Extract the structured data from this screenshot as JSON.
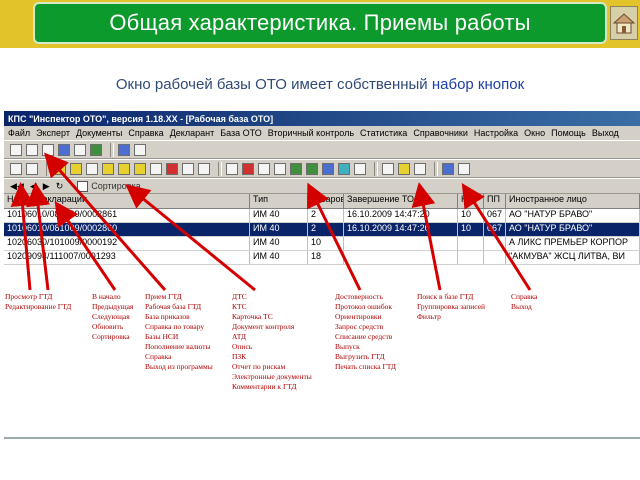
{
  "slide": {
    "title": "Общая характеристика.  Приемы работы",
    "subtitle_part1": "Окно рабочей базы ОТО имеет собственный ",
    "subtitle_part2": "набор кнопок"
  },
  "window": {
    "title": "КПС \"Инспектор ОТО\", версия 1.18.XX - [Рабочая база ОТО]",
    "menu": [
      "Файл",
      "Эксперт",
      "Документы",
      "Справка",
      "Декларант",
      "База ОТО",
      "Вторичный контроль",
      "Статистика",
      "Справочники",
      "Настройка",
      "Окно",
      "Помощь",
      "Выход"
    ],
    "checkbox_label": "Сортировка",
    "columns": [
      "Номер декларации",
      "Тип",
      "Товаров",
      "Завершение ТО",
      "Код",
      "ПП",
      "Иностранное лицо"
    ],
    "rows": [
      [
        "10106010/081009/0002861",
        "ИМ 40",
        "2",
        "16.10.2009 14:47:20",
        "10",
        "067",
        "АО \"НАТУР БРАВО\""
      ],
      [
        "10106010/081009/0002860",
        "ИМ 40",
        "2",
        "16.10.2009 14:47:20",
        "10",
        "067",
        "АО \"НАТУР БРАВО\""
      ],
      [
        "10206030/101009/0000192",
        "ИМ 40",
        "10",
        "",
        "",
        "",
        "А ЛИКС ПРЕМЬЕР КОРПОР"
      ],
      [
        "10209094/111007/0001293",
        "ИМ 40",
        "18",
        "",
        "",
        "",
        "\"АКМУВА\" ЖСЦ ЛИТВА, ВИ"
      ]
    ]
  },
  "legends": {
    "g1": [
      "Просмотр ГТД",
      "Редактирование ГТД"
    ],
    "g2": [
      "В начало",
      "Предыдущая",
      "Следующая",
      "Обновить",
      "Сортировка"
    ],
    "g3": [
      "Прием ГТД",
      "Рабочая база ГТД",
      "База приказов",
      "Справка по товару",
      "Базы НСИ",
      "Пополнение валюты",
      "Справка",
      "Выход из программы"
    ],
    "g4": [
      "ДТС",
      "КТС",
      "Карточка ТС",
      "Документ контроля",
      "АТД",
      "Опись",
      "ПЗК",
      "Отчет по рискам",
      "Электронные документы",
      "Комментарии к ГТД"
    ],
    "g5": [
      "Достоверность",
      "Протокол ошибок",
      "Ориентировки",
      "Запрос средств",
      "Списание средств",
      "Выпуск",
      "Выгрузить ГТД",
      "Печать списка ГТД"
    ],
    "g6": [
      "Поиск в базе ГТД",
      "Группировка записей",
      "Фильтр"
    ],
    "g7": [
      "Справка",
      "Выход"
    ]
  },
  "colors": {
    "accent_band": "#e2c32a",
    "title_bg": "#0c9a2c",
    "legend_text": "#b00000",
    "arrow": "#d40000",
    "selection": "#0a246a"
  },
  "icons": [
    "home-icon"
  ]
}
